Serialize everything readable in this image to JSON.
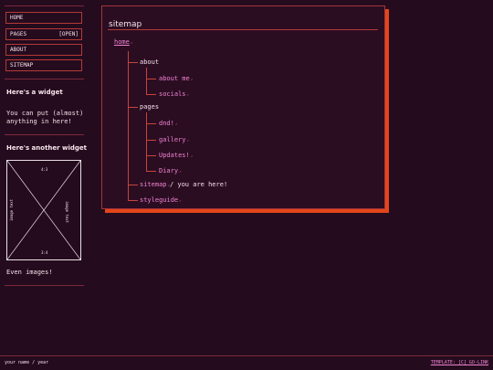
{
  "sidebar": {
    "nav": [
      {
        "label": "HOME",
        "badge": ""
      },
      {
        "label": "PAGES",
        "badge": "[OPEN]"
      },
      {
        "label": "ABOUT",
        "badge": ""
      },
      {
        "label": "SITEMAP",
        "badge": ""
      }
    ],
    "widget1": {
      "title": "Here's a widget",
      "text": "You can put (almost) anything in here!"
    },
    "widget2": {
      "title": "Here's another widget",
      "image_labels": {
        "top": "4:3",
        "bottom": "3:4",
        "left": "image text",
        "right": "image text"
      },
      "caption": "Even images!"
    }
  },
  "main": {
    "title": "sitemap",
    "tree": {
      "home": "home",
      "about": "about",
      "about_me": "about me",
      "socials": "socials",
      "pages": "pages",
      "dnd": "dnd!",
      "gallery": "gallery",
      "updates": "Updates!",
      "diary": "Diary",
      "sitemap": "sitemap",
      "sitemap_suffix": "/ you are here!",
      "styleguide": "styleguide"
    },
    "ext_mark": "↗"
  },
  "footer": {
    "left": "your name / year",
    "right": "TEMPLATE: [C] GO-LINK"
  },
  "colors": {
    "background": "#250b1e",
    "accent": "#e2461a",
    "link": "#ee82d2",
    "border": "#b23a36"
  }
}
